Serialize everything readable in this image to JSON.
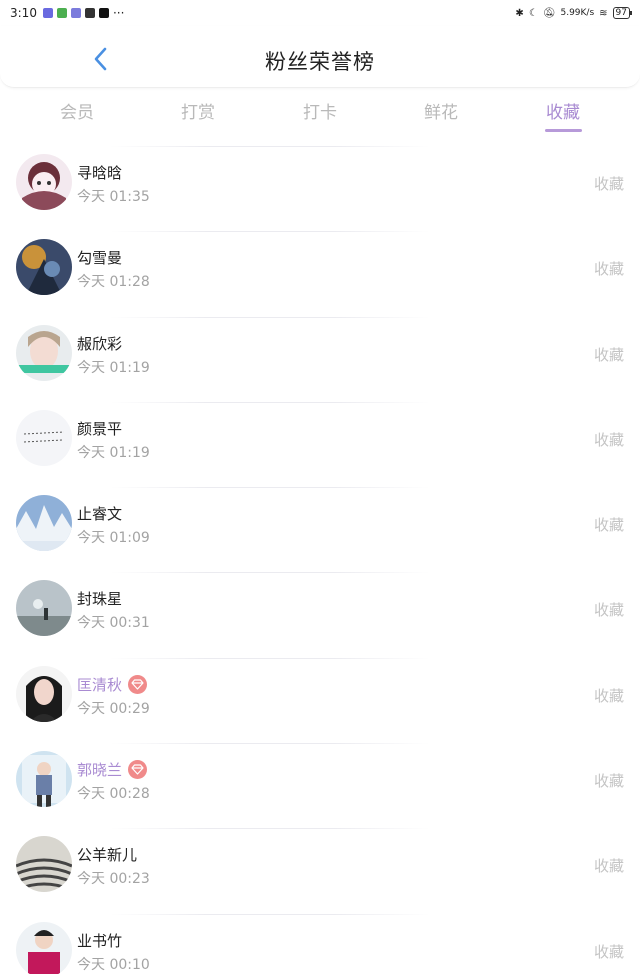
{
  "status_bar": {
    "time": "3:10",
    "dots": "···",
    "net_speed": "5.99K/s",
    "battery": "97"
  },
  "header": {
    "title": "粉丝荣誉榜"
  },
  "tabs": [
    {
      "label": "会员"
    },
    {
      "label": "打赏"
    },
    {
      "label": "打卡"
    },
    {
      "label": "鲜花"
    },
    {
      "label": "收藏"
    }
  ],
  "active_tab": "收藏",
  "colors": {
    "accent": "#a98bd2",
    "muted": "#a3a3a3",
    "action": "#c4c4c4",
    "vip_badge": "#f08a8a"
  },
  "rows": [
    {
      "name": "寻晗晗",
      "time": "今天 01:35",
      "action": "收藏",
      "vip": false
    },
    {
      "name": "勾雪曼",
      "time": "今天 01:28",
      "action": "收藏",
      "vip": false
    },
    {
      "name": "赧欣彩",
      "time": "今天 01:19",
      "action": "收藏",
      "vip": false
    },
    {
      "name": "颜景平",
      "time": "今天 01:19",
      "action": "收藏",
      "vip": false
    },
    {
      "name": "止睿文",
      "time": "今天 01:09",
      "action": "收藏",
      "vip": false
    },
    {
      "name": "封珠星",
      "time": "今天 00:31",
      "action": "收藏",
      "vip": false
    },
    {
      "name": "匡清秋",
      "time": "今天 00:29",
      "action": "收藏",
      "vip": true
    },
    {
      "name": "郭晓兰",
      "time": "今天 00:28",
      "action": "收藏",
      "vip": true
    },
    {
      "name": "公羊新儿",
      "time": "今天 00:23",
      "action": "收藏",
      "vip": false
    },
    {
      "name": "业书竹",
      "time": "今天 00:10",
      "action": "收藏",
      "vip": false
    }
  ]
}
